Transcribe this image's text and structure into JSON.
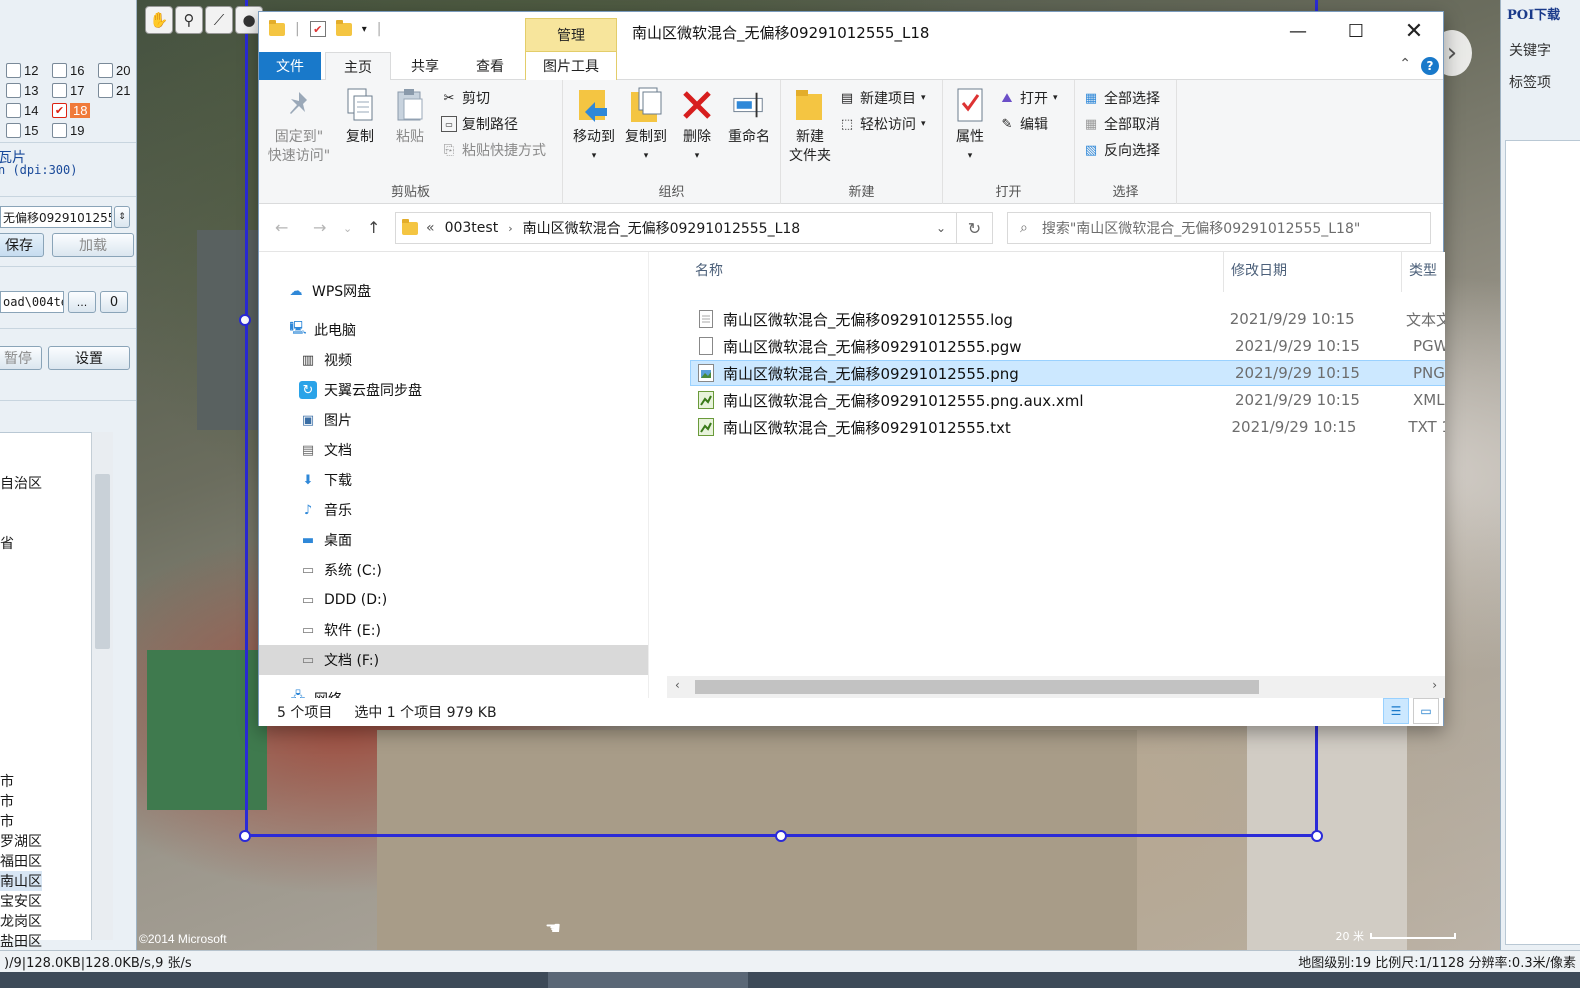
{
  "left_panel": {
    "levels": [
      {
        "num": "12",
        "checked": false
      },
      {
        "num": "16",
        "checked": false
      },
      {
        "num": "20",
        "checked": false
      },
      {
        "num": "13",
        "checked": false
      },
      {
        "num": "17",
        "checked": false
      },
      {
        "num": "21",
        "checked": false
      },
      {
        "num": "14",
        "checked": false
      },
      {
        "num": "18",
        "checked": true
      },
      {
        "num": "15",
        "checked": false
      },
      {
        "num": "19",
        "checked": false
      }
    ],
    "tile_label": "瓦片",
    "dpi_label": "n (dpi:300)",
    "task_name": "无偏移0929101255",
    "save_button": "保存",
    "load_button": "加载",
    "path_field": "oad\\004te",
    "browse_button": "...",
    "count_value": "0",
    "stop_button": "暂停",
    "settings_button": "设置",
    "regions_top": [
      "自治区",
      "省"
    ],
    "regions_bottom": [
      "市",
      "市",
      "市",
      "罗湖区",
      "福田区",
      "南山区",
      "宝安区",
      "龙岗区",
      "盐田区"
    ]
  },
  "map": {
    "copyright": "©2014 Microsoft",
    "scale_label": "20 米",
    "tools": [
      "hand-icon",
      "pin-icon",
      "polyline-icon",
      "circle-icon"
    ]
  },
  "right_panel": {
    "title": "POI下载",
    "keyword_label": "关键字",
    "tag_label": "标签项"
  },
  "statusbar": {
    "left": ")/9|128.0KB|128.0KB/s,9 张/s",
    "right": "地图级别:19 比例尺:1/1128 分辨率:0.3米/像素"
  },
  "explorer": {
    "manage_tab": "管理",
    "title": "南山区微软混合_无偏移09291012555_L18",
    "tabs": {
      "file": "文件",
      "home": "主页",
      "share": "共享",
      "view": "查看",
      "picture_tools": "图片工具"
    },
    "ribbon": {
      "clipboard": {
        "label": "剪贴板",
        "pin": "固定到\"\n快速访问\"",
        "copy": "复制",
        "paste": "粘贴",
        "cut": "剪切",
        "copy_path": "复制路径",
        "paste_shortcut": "粘贴快捷方式"
      },
      "organize": {
        "label": "组织",
        "move_to": "移动到",
        "copy_to": "复制到",
        "delete": "删除",
        "rename": "重命名"
      },
      "new": {
        "label": "新建",
        "new_folder": "新建\n文件夹",
        "new_item": "新建项目",
        "easy_access": "轻松访问"
      },
      "open": {
        "label": "打开",
        "properties": "属性",
        "open": "打开",
        "edit": "编辑"
      },
      "select": {
        "label": "选择",
        "select_all": "全部选择",
        "select_none": "全部取消",
        "invert": "反向选择"
      }
    },
    "address": {
      "prefix": "«",
      "crumbs": [
        "003test",
        "南山区微软混合_无偏移09291012555_L18"
      ],
      "search_placeholder": "搜索\"南山区微软混合_无偏移09291012555_L18\""
    },
    "nav": [
      {
        "label": "WPS网盘",
        "icon": "cloud-icon"
      },
      {
        "label": "此电脑",
        "icon": "computer-icon"
      },
      {
        "label": "视频",
        "icon": "video-icon"
      },
      {
        "label": "天翼云盘同步盘",
        "icon": "sync-icon"
      },
      {
        "label": "图片",
        "icon": "pictures-icon"
      },
      {
        "label": "文档",
        "icon": "documents-icon"
      },
      {
        "label": "下载",
        "icon": "download-icon"
      },
      {
        "label": "音乐",
        "icon": "music-icon"
      },
      {
        "label": "桌面",
        "icon": "desktop-icon"
      },
      {
        "label": "系统 (C:)",
        "icon": "drive-icon"
      },
      {
        "label": "DDD (D:)",
        "icon": "drive-icon"
      },
      {
        "label": "软件 (E:)",
        "icon": "drive-icon"
      },
      {
        "label": "文档 (F:)",
        "icon": "drive-icon"
      },
      {
        "label": "网络",
        "icon": "network-icon"
      }
    ],
    "columns": {
      "name": "名称",
      "date": "修改日期",
      "type": "类型"
    },
    "files": [
      {
        "name": "南山区微软混合_无偏移09291012555.log",
        "date": "2021/9/29 10:15",
        "type": "文本文",
        "icon": "text-file-icon"
      },
      {
        "name": "南山区微软混合_无偏移09291012555.pgw",
        "date": "2021/9/29 10:15",
        "type": "PGW",
        "icon": "blank-file-icon"
      },
      {
        "name": "南山区微软混合_无偏移09291012555.png",
        "date": "2021/9/29 10:15",
        "type": "PNG",
        "icon": "image-file-icon",
        "selected": true
      },
      {
        "name": "南山区微软混合_无偏移09291012555.png.aux.xml",
        "date": "2021/9/29 10:15",
        "type": "XML",
        "icon": "xml-file-icon"
      },
      {
        "name": "南山区微软混合_无偏移09291012555.txt",
        "date": "2021/9/29 10:15",
        "type": "TXT 1",
        "icon": "txt-file-icon"
      }
    ],
    "status": {
      "count": "5 个项目",
      "selection": "选中 1 个项目  979 KB"
    }
  },
  "colors": {
    "accent": "#1979ca",
    "selection": "#cce8ff",
    "manage_tab": "#f7e59c",
    "map_selection": "#2a2ad8"
  }
}
